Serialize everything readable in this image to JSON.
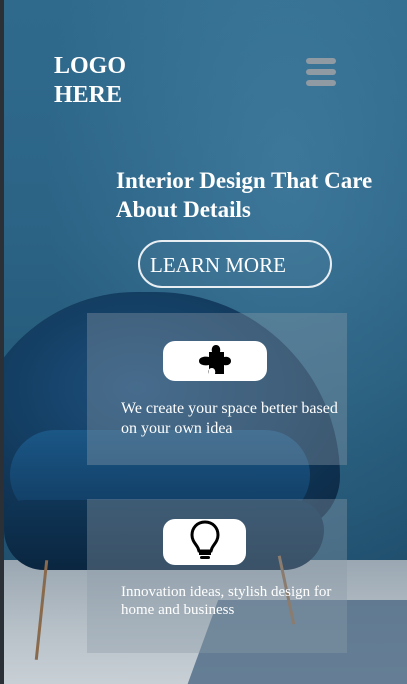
{
  "header": {
    "logo_text": "LOGO HERE",
    "menu_icon": "hamburger-menu-icon"
  },
  "hero": {
    "headline": "Interior Design That Care About Details",
    "cta_label": "LEARN MORE"
  },
  "features": [
    {
      "icon": "puzzle-piece-icon",
      "text": "We create your space better based on your own idea"
    },
    {
      "icon": "lightbulb-icon",
      "text": "Innovation ideas, stylish design for home and business"
    }
  ],
  "colors": {
    "background_blue": "#2b6385",
    "card_overlay": "#8c9ba8",
    "text": "#ffffff",
    "menu_bars": "#8f9aa3"
  }
}
